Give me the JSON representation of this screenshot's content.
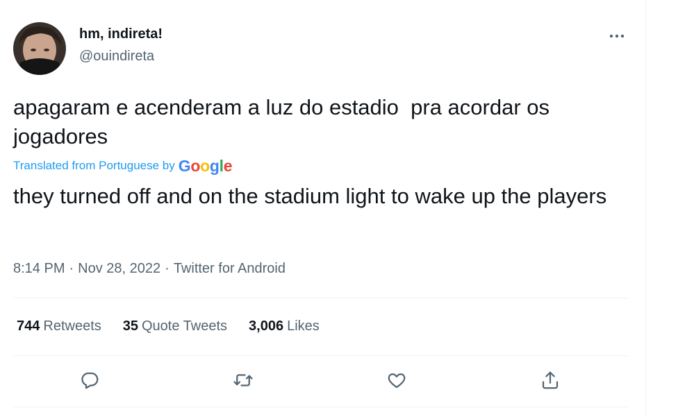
{
  "tweet": {
    "author": {
      "display_name": "hm, indireta!",
      "handle": "@ouindireta"
    },
    "text": "apagaram e acenderam a luz do estadio  pra acordar os jogadores",
    "translation": {
      "label": "Translated from Portuguese by",
      "provider": "Google",
      "text": "they turned off and on the stadium light to wake up the players"
    },
    "meta": {
      "time": "8:14 PM",
      "separator": "·",
      "date": "Nov 28, 2022",
      "source": "Twitter for Android"
    },
    "stats": {
      "retweets": {
        "count": "744",
        "label": "Retweets"
      },
      "quote_tweets": {
        "count": "35",
        "label": "Quote Tweets"
      },
      "likes": {
        "count": "3,006",
        "label": "Likes"
      }
    },
    "actions": {
      "reply_icon": "reply-icon",
      "retweet_icon": "retweet-icon",
      "like_icon": "heart-icon",
      "share_icon": "share-icon",
      "more_icon": "more-dots-icon"
    },
    "colors": {
      "text": "#0f1419",
      "secondary": "#536471",
      "link": "#1d9bf0",
      "divider": "#eff3f4"
    }
  }
}
